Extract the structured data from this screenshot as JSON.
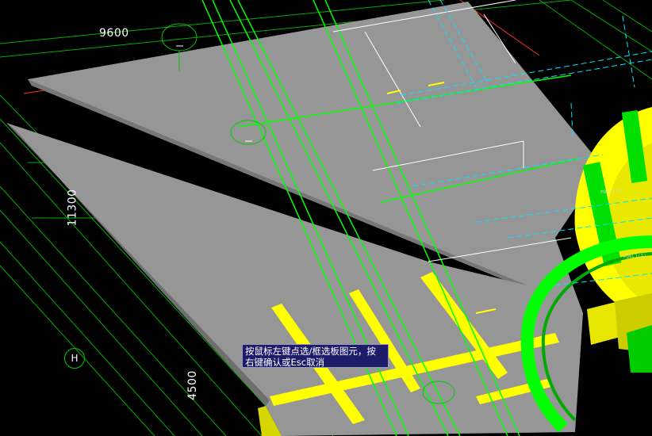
{
  "dimensions": {
    "d1": "9600",
    "d2": "11300",
    "d3": "4500"
  },
  "axis_bubbles": {
    "h": "H"
  },
  "status_tip": {
    "line1": "按鼠标左键点选/框选板图元，按",
    "line2": "右键确认或Esc取消"
  },
  "member_labels": {
    "beam1": "PDKL1(1)",
    "beam2": "PDKL1(1)"
  },
  "colors": {
    "background": "#000000",
    "slab": "#959595",
    "grid": "#00cc00",
    "beam": "#ffff00",
    "rebar": "#00ff00",
    "dimension": "#ffffff",
    "axis_red": "#ff3030",
    "aux_cyan": "#00e5ff",
    "tooltip_bg": "#1c1c6a"
  }
}
